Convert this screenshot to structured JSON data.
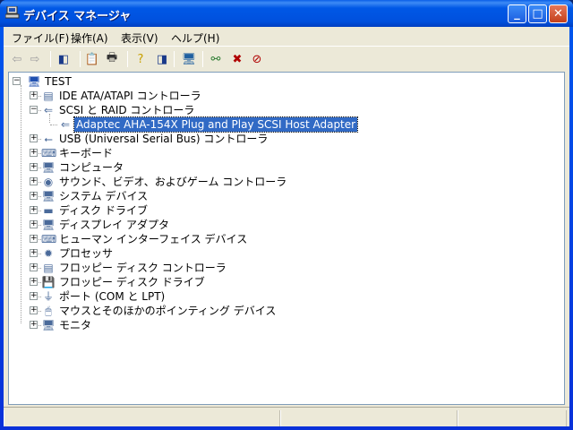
{
  "window": {
    "title": "デバイス マネージャ",
    "minimize": "_",
    "maximize": "□",
    "close": "✕"
  },
  "menu": [
    "ファイル(F)",
    "操作(A)",
    "表示(V)",
    "ヘルプ(H)"
  ],
  "toolbar": [
    {
      "name": "back-icon",
      "glyph": "⇦",
      "color": "#a0a0a0"
    },
    {
      "name": "forward-icon",
      "glyph": "⇨",
      "color": "#a0a0a0"
    },
    {
      "name": "show-hide-console-tree-icon",
      "glyph": "◧",
      "color": "#1a3a8a"
    },
    {
      "name": "properties-icon",
      "glyph": "📋",
      "color": "#333"
    },
    {
      "name": "print-icon",
      "glyph": "🖶",
      "color": "#333"
    },
    {
      "name": "help-icon",
      "glyph": "?",
      "color": "#c8a000"
    },
    {
      "name": "show-hide-action-pane-icon",
      "glyph": "◨",
      "color": "#1a3a8a"
    },
    {
      "name": "scan-hardware-icon",
      "glyph": "🖥",
      "color": "#2060a0"
    },
    {
      "name": "update-driver-icon",
      "glyph": "⚯",
      "color": "#2e7d32"
    },
    {
      "name": "uninstall-icon",
      "glyph": "✖",
      "color": "#b00000"
    },
    {
      "name": "disable-icon",
      "glyph": "⊘",
      "color": "#b00000"
    }
  ],
  "tree": {
    "root": "TEST",
    "items": [
      {
        "label": "IDE ATA/ATAPI コントローラ",
        "icon": "ide-controller-icon",
        "glyph": "▤",
        "level": 1,
        "expander": "+"
      },
      {
        "label": "SCSI と RAID コントローラ",
        "icon": "scsi-controller-icon",
        "glyph": "⇐",
        "level": 1,
        "expander": "−"
      },
      {
        "label": "Adaptec AHA-154X Plug and Play SCSI Host Adapter",
        "icon": "scsi-adapter-icon",
        "glyph": "⇐",
        "level": 2,
        "selected": true
      },
      {
        "label": "USB (Universal Serial Bus) コントローラ",
        "icon": "usb-icon",
        "glyph": "⭠",
        "level": 1,
        "expander": "+"
      },
      {
        "label": "キーボード",
        "icon": "keyboard-icon",
        "glyph": "⌨",
        "level": 1,
        "expander": "+"
      },
      {
        "label": "コンピュータ",
        "icon": "computer-icon",
        "glyph": "🖥",
        "level": 1,
        "expander": "+"
      },
      {
        "label": "サウンド、ビデオ、およびゲーム コントローラ",
        "icon": "sound-icon",
        "glyph": "◉",
        "level": 1,
        "expander": "+"
      },
      {
        "label": "システム デバイス",
        "icon": "system-devices-icon",
        "glyph": "🖥",
        "level": 1,
        "expander": "+"
      },
      {
        "label": "ディスク ドライブ",
        "icon": "disk-drive-icon",
        "glyph": "▬",
        "level": 1,
        "expander": "+"
      },
      {
        "label": "ディスプレイ アダプタ",
        "icon": "display-adapter-icon",
        "glyph": "🖥",
        "level": 1,
        "expander": "+"
      },
      {
        "label": "ヒューマン インターフェイス デバイス",
        "icon": "hid-icon",
        "glyph": "⌨",
        "level": 1,
        "expander": "+"
      },
      {
        "label": "プロセッサ",
        "icon": "processor-icon",
        "glyph": "✹",
        "level": 1,
        "expander": "+"
      },
      {
        "label": "フロッピー ディスク コントローラ",
        "icon": "floppy-controller-icon",
        "glyph": "▤",
        "level": 1,
        "expander": "+"
      },
      {
        "label": "フロッピー ディスク ドライブ",
        "icon": "floppy-drive-icon",
        "glyph": "💾",
        "level": 1,
        "expander": "+"
      },
      {
        "label": "ポート (COM と LPT)",
        "icon": "port-icon",
        "glyph": "⏚",
        "level": 1,
        "expander": "+"
      },
      {
        "label": "マウスとそのほかのポインティング デバイス",
        "icon": "mouse-icon",
        "glyph": "🖱",
        "level": 1,
        "expander": "+"
      },
      {
        "label": "モニタ",
        "icon": "monitor-icon",
        "glyph": "🖥",
        "level": 1,
        "expander": "+"
      }
    ]
  },
  "colors": {
    "selection": "#316ac5",
    "titlebar": "#0058e6",
    "face": "#ece9d8"
  }
}
